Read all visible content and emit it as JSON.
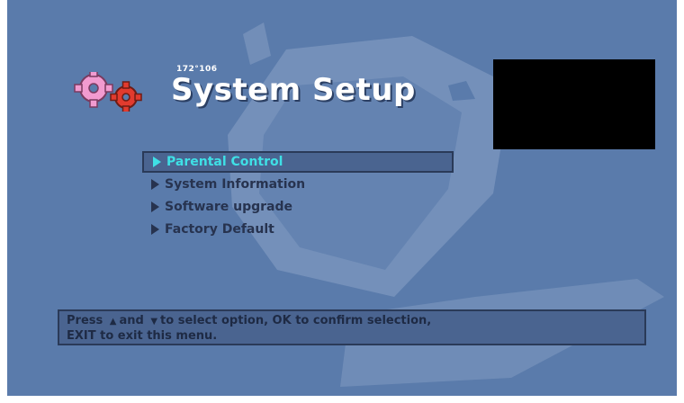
{
  "screen": {
    "channel_code": "172°106",
    "title": "System Setup",
    "menu": {
      "items": [
        {
          "label": "Parental Control",
          "selected": true
        },
        {
          "label": "System Information",
          "selected": false
        },
        {
          "label": "Software upgrade",
          "selected": false
        },
        {
          "label": "Factory Default",
          "selected": false
        }
      ]
    },
    "help": {
      "part1": "Press",
      "part2": "and",
      "part3": "to select option, OK to confirm selection,",
      "line2": "EXIT to exit this menu.",
      "up_icon": "▲",
      "down_icon": "▼"
    },
    "colors": {
      "background": "#5a7bab",
      "selected_text": "#3fe0e6",
      "menu_text": "#27334f",
      "gear_pink": "#f29bd0",
      "gear_red": "#e23b2e"
    },
    "icons": {
      "gears": "gears-icon",
      "arrow": "triangle-right-icon"
    }
  }
}
